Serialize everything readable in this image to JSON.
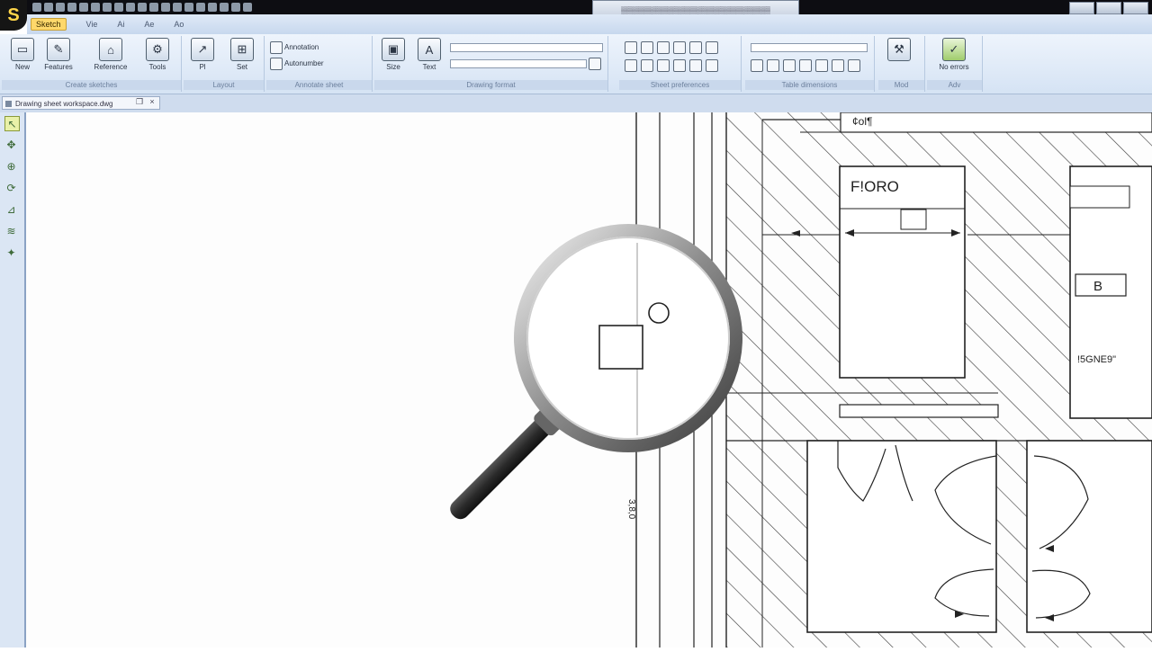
{
  "app": {
    "logo": "S",
    "title": "▒▒▒▒▒▒▒▒▒▒▒▒▒▒▒▒▒▒▒▒▒▒▒▒▒▒"
  },
  "tabs": [
    {
      "label": "Sketch",
      "active": true
    },
    {
      "label": "Vie"
    },
    {
      "label": "Ai"
    },
    {
      "label": "Ae"
    },
    {
      "label": "Ao"
    }
  ],
  "ribbon": {
    "groups": [
      {
        "label": "Create sketches",
        "buttons": [
          "New",
          "Features",
          "Reference",
          "Tools"
        ]
      },
      {
        "label": "Layout",
        "buttons": [
          "Pl",
          "Set"
        ]
      },
      {
        "label": "Annotate sheet",
        "items": [
          "Annotation",
          "Autonumber"
        ]
      },
      {
        "label": "Drawing format",
        "items": [
          "Size",
          "Text"
        ]
      },
      {
        "label": "Sheet preferences",
        "items": []
      },
      {
        "label": "Table dimensions",
        "items": []
      },
      {
        "label": "Mod"
      },
      {
        "label": "Adv",
        "buttons": [
          "No errors"
        ]
      }
    ]
  },
  "document": {
    "tab_label": "Drawing sheet workspace.dwg"
  },
  "drawing": {
    "label_top": "¢ol¶",
    "label_room": "F!ORO",
    "label_b": "B",
    "label_note": "!5GNE9\"",
    "label_vertical": "3,8,0"
  }
}
